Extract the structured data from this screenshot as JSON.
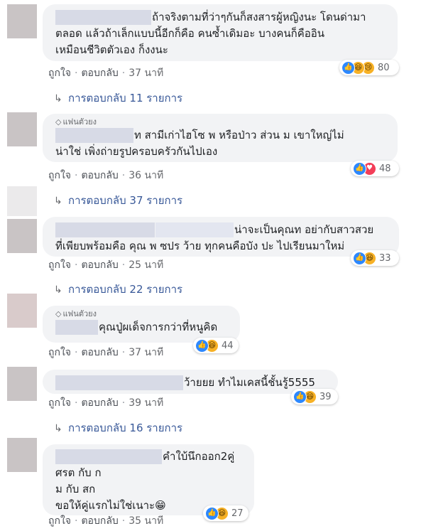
{
  "comments": [
    {
      "lines": [
        "ถ้าจริงตามที่ว่าๆกันก็สงสารผู้หญิงนะ โดนด่ามา",
        "ตลอด แล้วถ้าเล็กแบบนี้อีกก็คือ คนซ้ำเดิมอะ บางคนก็คืออิน",
        "เหมือนชีวิตตัวเอง ก็งงนะ"
      ],
      "like": "ถูกใจ",
      "reply": "ตอบกลับ",
      "time": "37 นาที",
      "reactions": [
        "like",
        "haha",
        "sad"
      ],
      "reaction_count": "80",
      "replies_label": "การตอบกลับ 11 รายการ"
    },
    {
      "badge": "แฟนตัวยง",
      "lines": [
        "ท สามีเก่าไฮโซ พ หรือป่าว ส่วน ม เขาใหญ่ไม่",
        "น่าใช่ เพิ่งถ่ายรูปครอบครัวกันไปเอง"
      ],
      "like": "ถูกใจ",
      "reply": "ตอบกลับ",
      "time": "36 นาที",
      "reactions": [
        "like",
        "love"
      ],
      "reaction_count": "48",
      "replies_label": "การตอบกลับ 37 รายการ"
    },
    {
      "lines": [
        "น่าจะเป็นคุณท อย่ากับสาวสวย",
        "ที่เพียบพร้อมคือ คุณ พ ซปร ว้าย ทุกคนคือบัง ปะ ไปเรียนมาใหม่"
      ],
      "like": "ถูกใจ",
      "reply": "ตอบกลับ",
      "time": "25 นาที",
      "reactions": [
        "like",
        "haha"
      ],
      "reaction_count": "33",
      "replies_label": "การตอบกลับ 22 รายการ"
    },
    {
      "badge": "แฟนตัวยง",
      "lines": [
        "คุณปู่ผเด็จการกว่าที่หนูคิด"
      ],
      "like": "ถูกใจ",
      "reply": "ตอบกลับ",
      "time": "37 นาที",
      "reactions": [
        "like",
        "haha"
      ],
      "reaction_count": "44"
    },
    {
      "lines": [
        "ว้ายยย ทำไมเคสนี้ชั้นรู้5555"
      ],
      "like": "ถูกใจ",
      "reply": "ตอบกลับ",
      "time": "39 นาที",
      "reactions": [
        "like",
        "haha"
      ],
      "reaction_count": "39",
      "replies_label": "การตอบกลับ 16 รายการ"
    },
    {
      "lines": [
        "คำใบ้นึกออก2คู่",
        "ศรต กับ ก",
        "ม กับ สก",
        "ขอให้คู่แรกไม่ใช่เนาะ😁"
      ],
      "like": "ถูกใจ",
      "reply": "ตอบกลับ",
      "time": "35 นาที",
      "reactions": [
        "like",
        "haha"
      ],
      "reaction_count": "27"
    }
  ],
  "colors": {
    "link": "#385898",
    "meta": "#65676b",
    "bubble": "#f2f3f5",
    "like": "#2d88ff",
    "love": "#f33e58",
    "haha": "#f7b125"
  },
  "icons": {
    "badge": "diamond-icon",
    "replies": "reply-arrow-icon",
    "like": "thumbs-up-icon",
    "love": "heart-icon",
    "haha": "laughing-face-icon",
    "sad": "crying-face-icon"
  }
}
